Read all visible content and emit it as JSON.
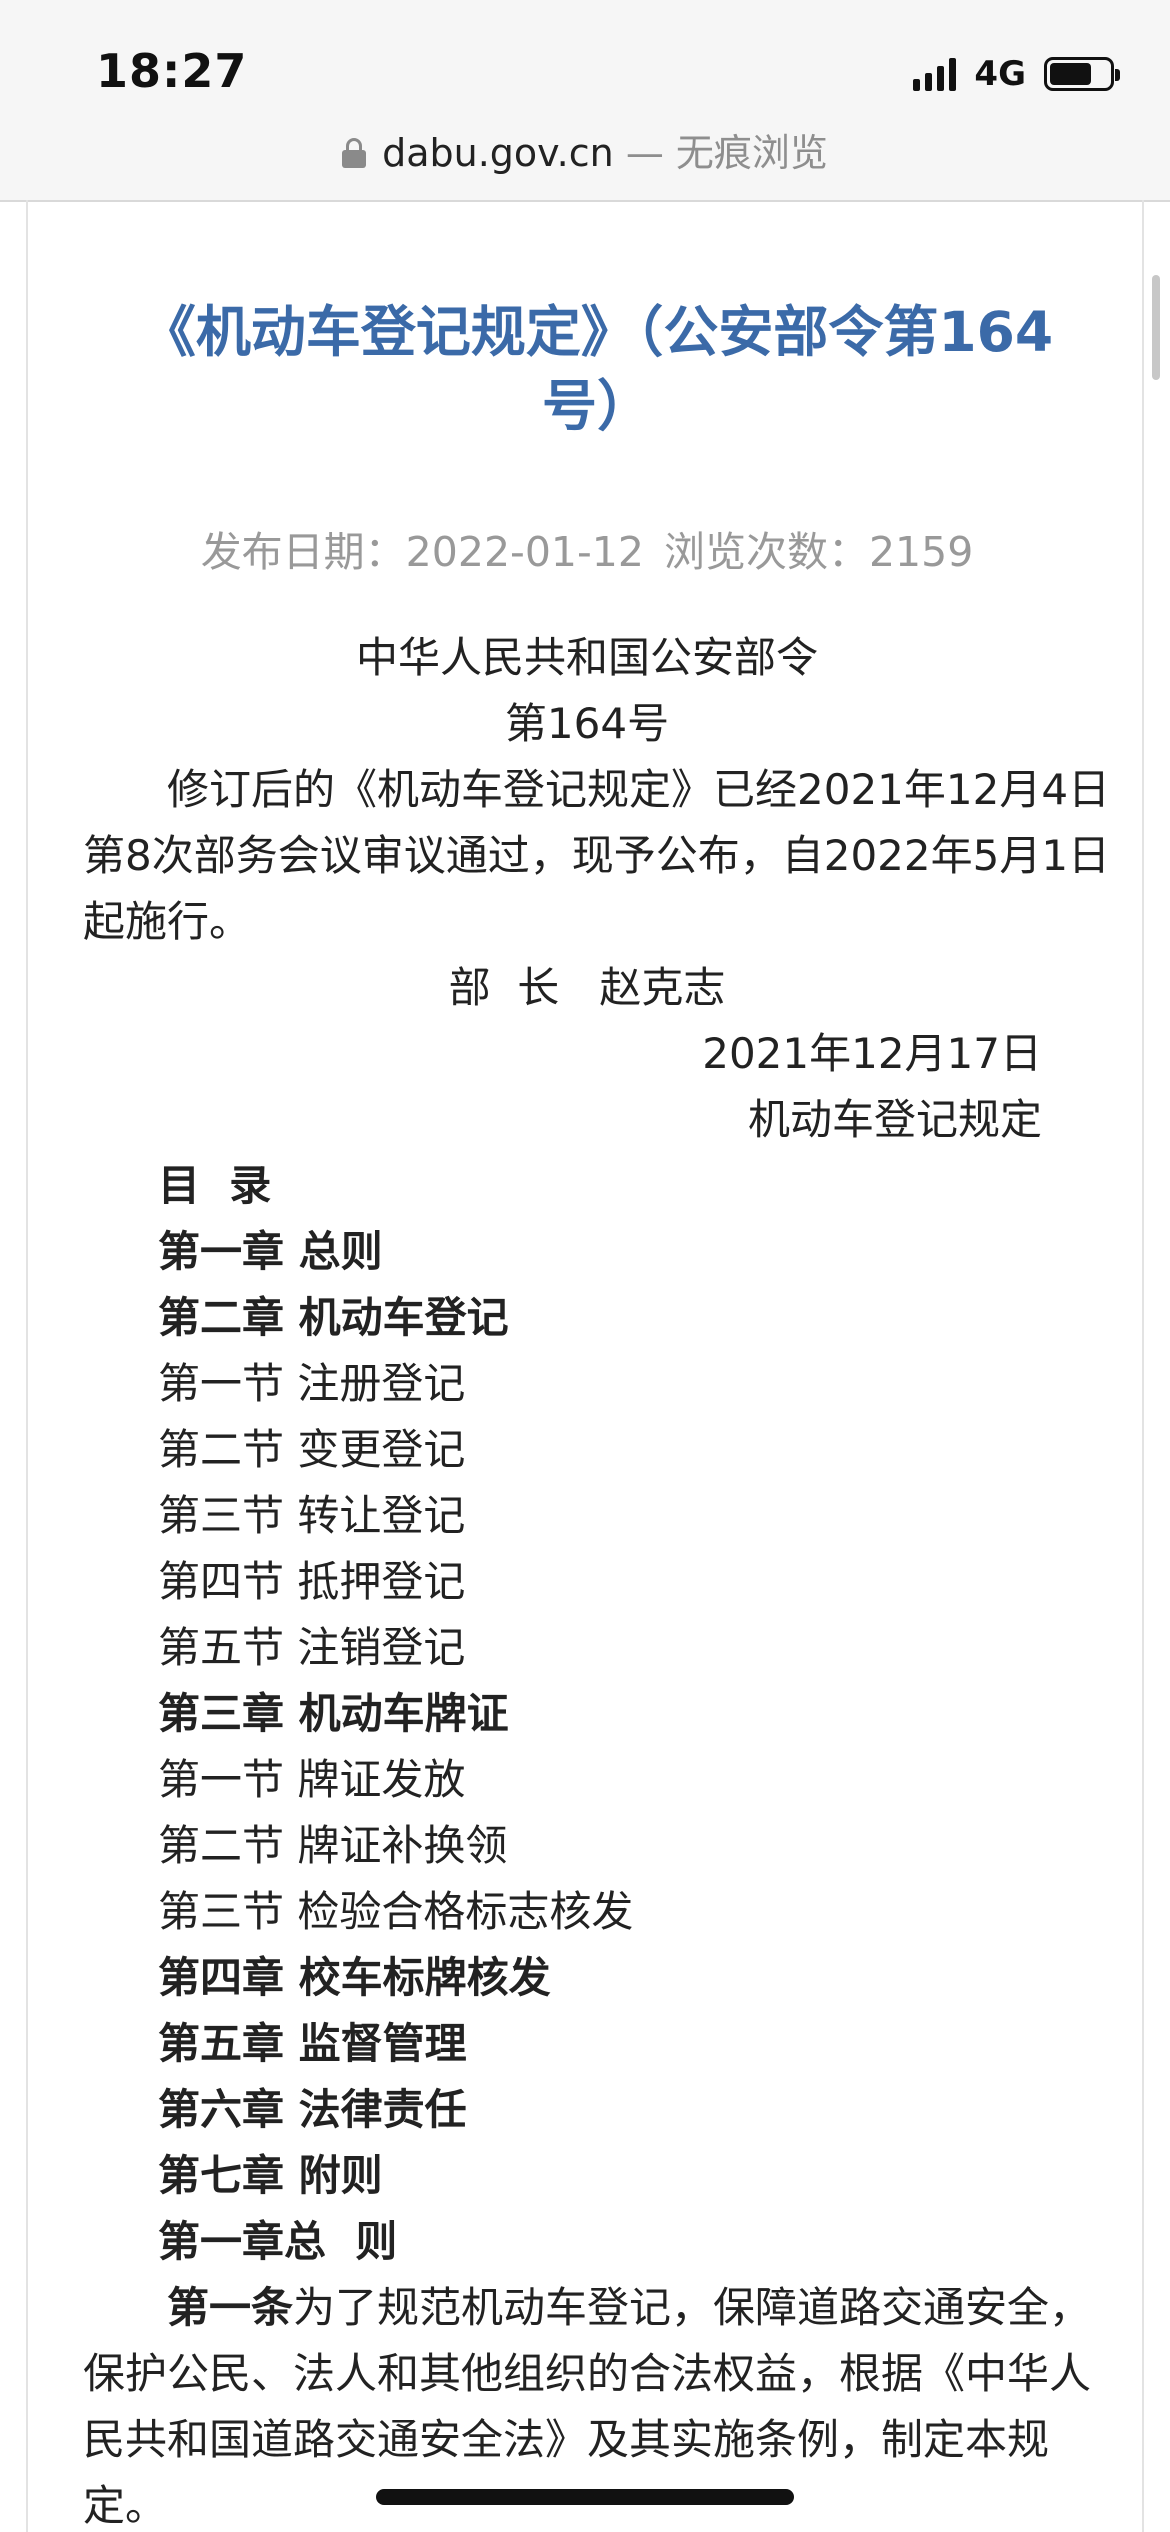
{
  "status_bar": {
    "time": "18:27",
    "network": "4G",
    "battery_level": 0.7
  },
  "address_bar": {
    "domain": "dabu.gov.cn",
    "separator": " — ",
    "mode": "无痕浏览"
  },
  "article": {
    "title": "《机动车登记规定》（公安部令第164号）",
    "publish_label": "发布日期：2022-01-12",
    "views_label": "浏览次数：2159",
    "issuer": "中华人民共和国公安部令",
    "order_no": "第164号",
    "intro": "修订后的《机动车登记规定》已经2021年12月4日第8次部务会议审议通过，现予公布，自2022年5月1日起施行。",
    "signature": "部  长   赵克志",
    "date": "2021年12月17日",
    "doc_name": "机动车登记规定",
    "toc_heading": "目  录",
    "toc": [
      {
        "text": "第一章 总则",
        "bold": true
      },
      {
        "text": "第二章 机动车登记",
        "bold": true
      },
      {
        "text": "第一节 注册登记",
        "bold": false
      },
      {
        "text": "第二节 变更登记",
        "bold": false
      },
      {
        "text": "第三节 转让登记",
        "bold": false
      },
      {
        "text": "第四节 抵押登记",
        "bold": false
      },
      {
        "text": "第五节 注销登记",
        "bold": false
      },
      {
        "text": "第三章 机动车牌证",
        "bold": true
      },
      {
        "text": "第一节 牌证发放",
        "bold": false
      },
      {
        "text": "第二节 牌证补换领",
        "bold": false
      },
      {
        "text": "第三节 检验合格标志核发",
        "bold": false
      },
      {
        "text": "第四章 校车标牌核发",
        "bold": true
      },
      {
        "text": "第五章 监督管理",
        "bold": true
      },
      {
        "text": "第六章 法律责任",
        "bold": true
      },
      {
        "text": "第七章 附则",
        "bold": true
      }
    ],
    "chapter1_heading": "第一章总  则",
    "article1_label": "第一条",
    "article1_text": "为了规范机动车登记，保障道路交通安全，保护公民、法人和其他组织的合法权益，根据《中华人民共和国道路交通安全法》及其实施条例，制定本规定。"
  }
}
